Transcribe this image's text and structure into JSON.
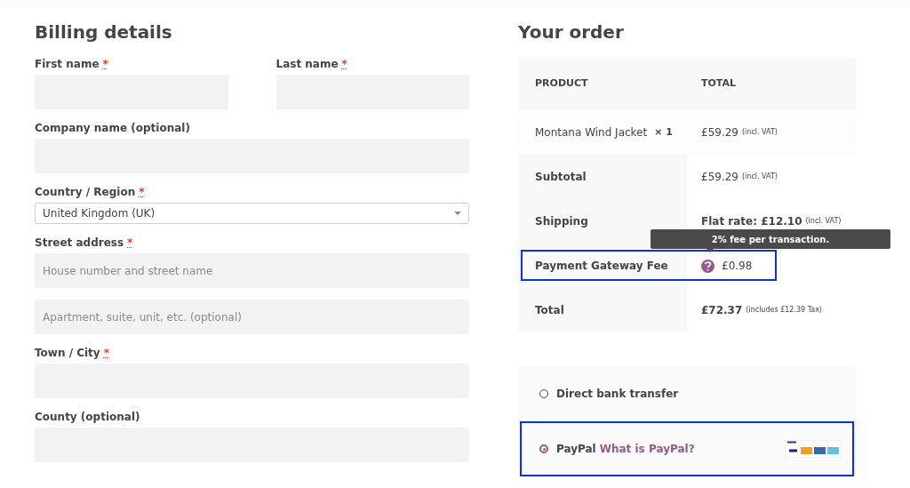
{
  "billing": {
    "title": "Billing details",
    "rows": [
      {
        "fields": [
          {
            "kind": "text",
            "label": "First name",
            "required": true
          },
          {
            "kind": "text",
            "label": "Last name",
            "required": true
          }
        ]
      },
      {
        "fields": [
          {
            "kind": "text",
            "label": "Company name (optional)",
            "required": false
          }
        ]
      },
      {
        "fields": [
          {
            "kind": "select",
            "label": "Country / Region",
            "required": true,
            "value": "United Kingdom (UK)"
          }
        ]
      },
      {
        "fields": [
          {
            "kind": "text",
            "label": "Street address",
            "required": true,
            "placeholder": "House number and street name"
          }
        ]
      },
      {
        "fields": [
          {
            "kind": "text",
            "placeholder": "Apartment, suite, unit, etc. (optional)",
            "required": false
          }
        ]
      },
      {
        "fields": [
          {
            "kind": "text",
            "label": "Town / City",
            "required": true
          }
        ]
      },
      {
        "fields": [
          {
            "kind": "text",
            "label": "County (optional)",
            "required": false
          }
        ]
      }
    ],
    "required_mark": "*"
  },
  "order": {
    "title": "Your order",
    "columns": [
      "PRODUCT",
      "TOTAL"
    ],
    "rows": [
      {
        "kind": "item",
        "label": "Montana Wind Jacket",
        "quantity": "× 1",
        "amount": "£59.29",
        "note": "(incl. VAT)"
      },
      {
        "kind": "summary",
        "label": "Subtotal",
        "amount": "£59.29",
        "note": "(incl. VAT)"
      },
      {
        "kind": "summary",
        "label": "Shipping",
        "amount": "Flat rate: £12.10",
        "note": "(incl. VAT)",
        "bold_amount": true
      },
      {
        "kind": "fee",
        "label": "Payment Gateway Fee",
        "amount": "£0.98",
        "tooltip": "2% fee per transaction.",
        "highlighted": true
      },
      {
        "kind": "summary",
        "label": "Total",
        "amount": "£72.37",
        "note": "(includes £12.39 Tax)",
        "bold_amount": true
      }
    ]
  },
  "payment_methods": [
    {
      "label": "Direct bank transfer",
      "selected": false,
      "highlighted": false
    },
    {
      "label": "PayPal",
      "link": "What is PayPal?",
      "selected": true,
      "highlighted": true,
      "card_logos": true
    }
  ]
}
